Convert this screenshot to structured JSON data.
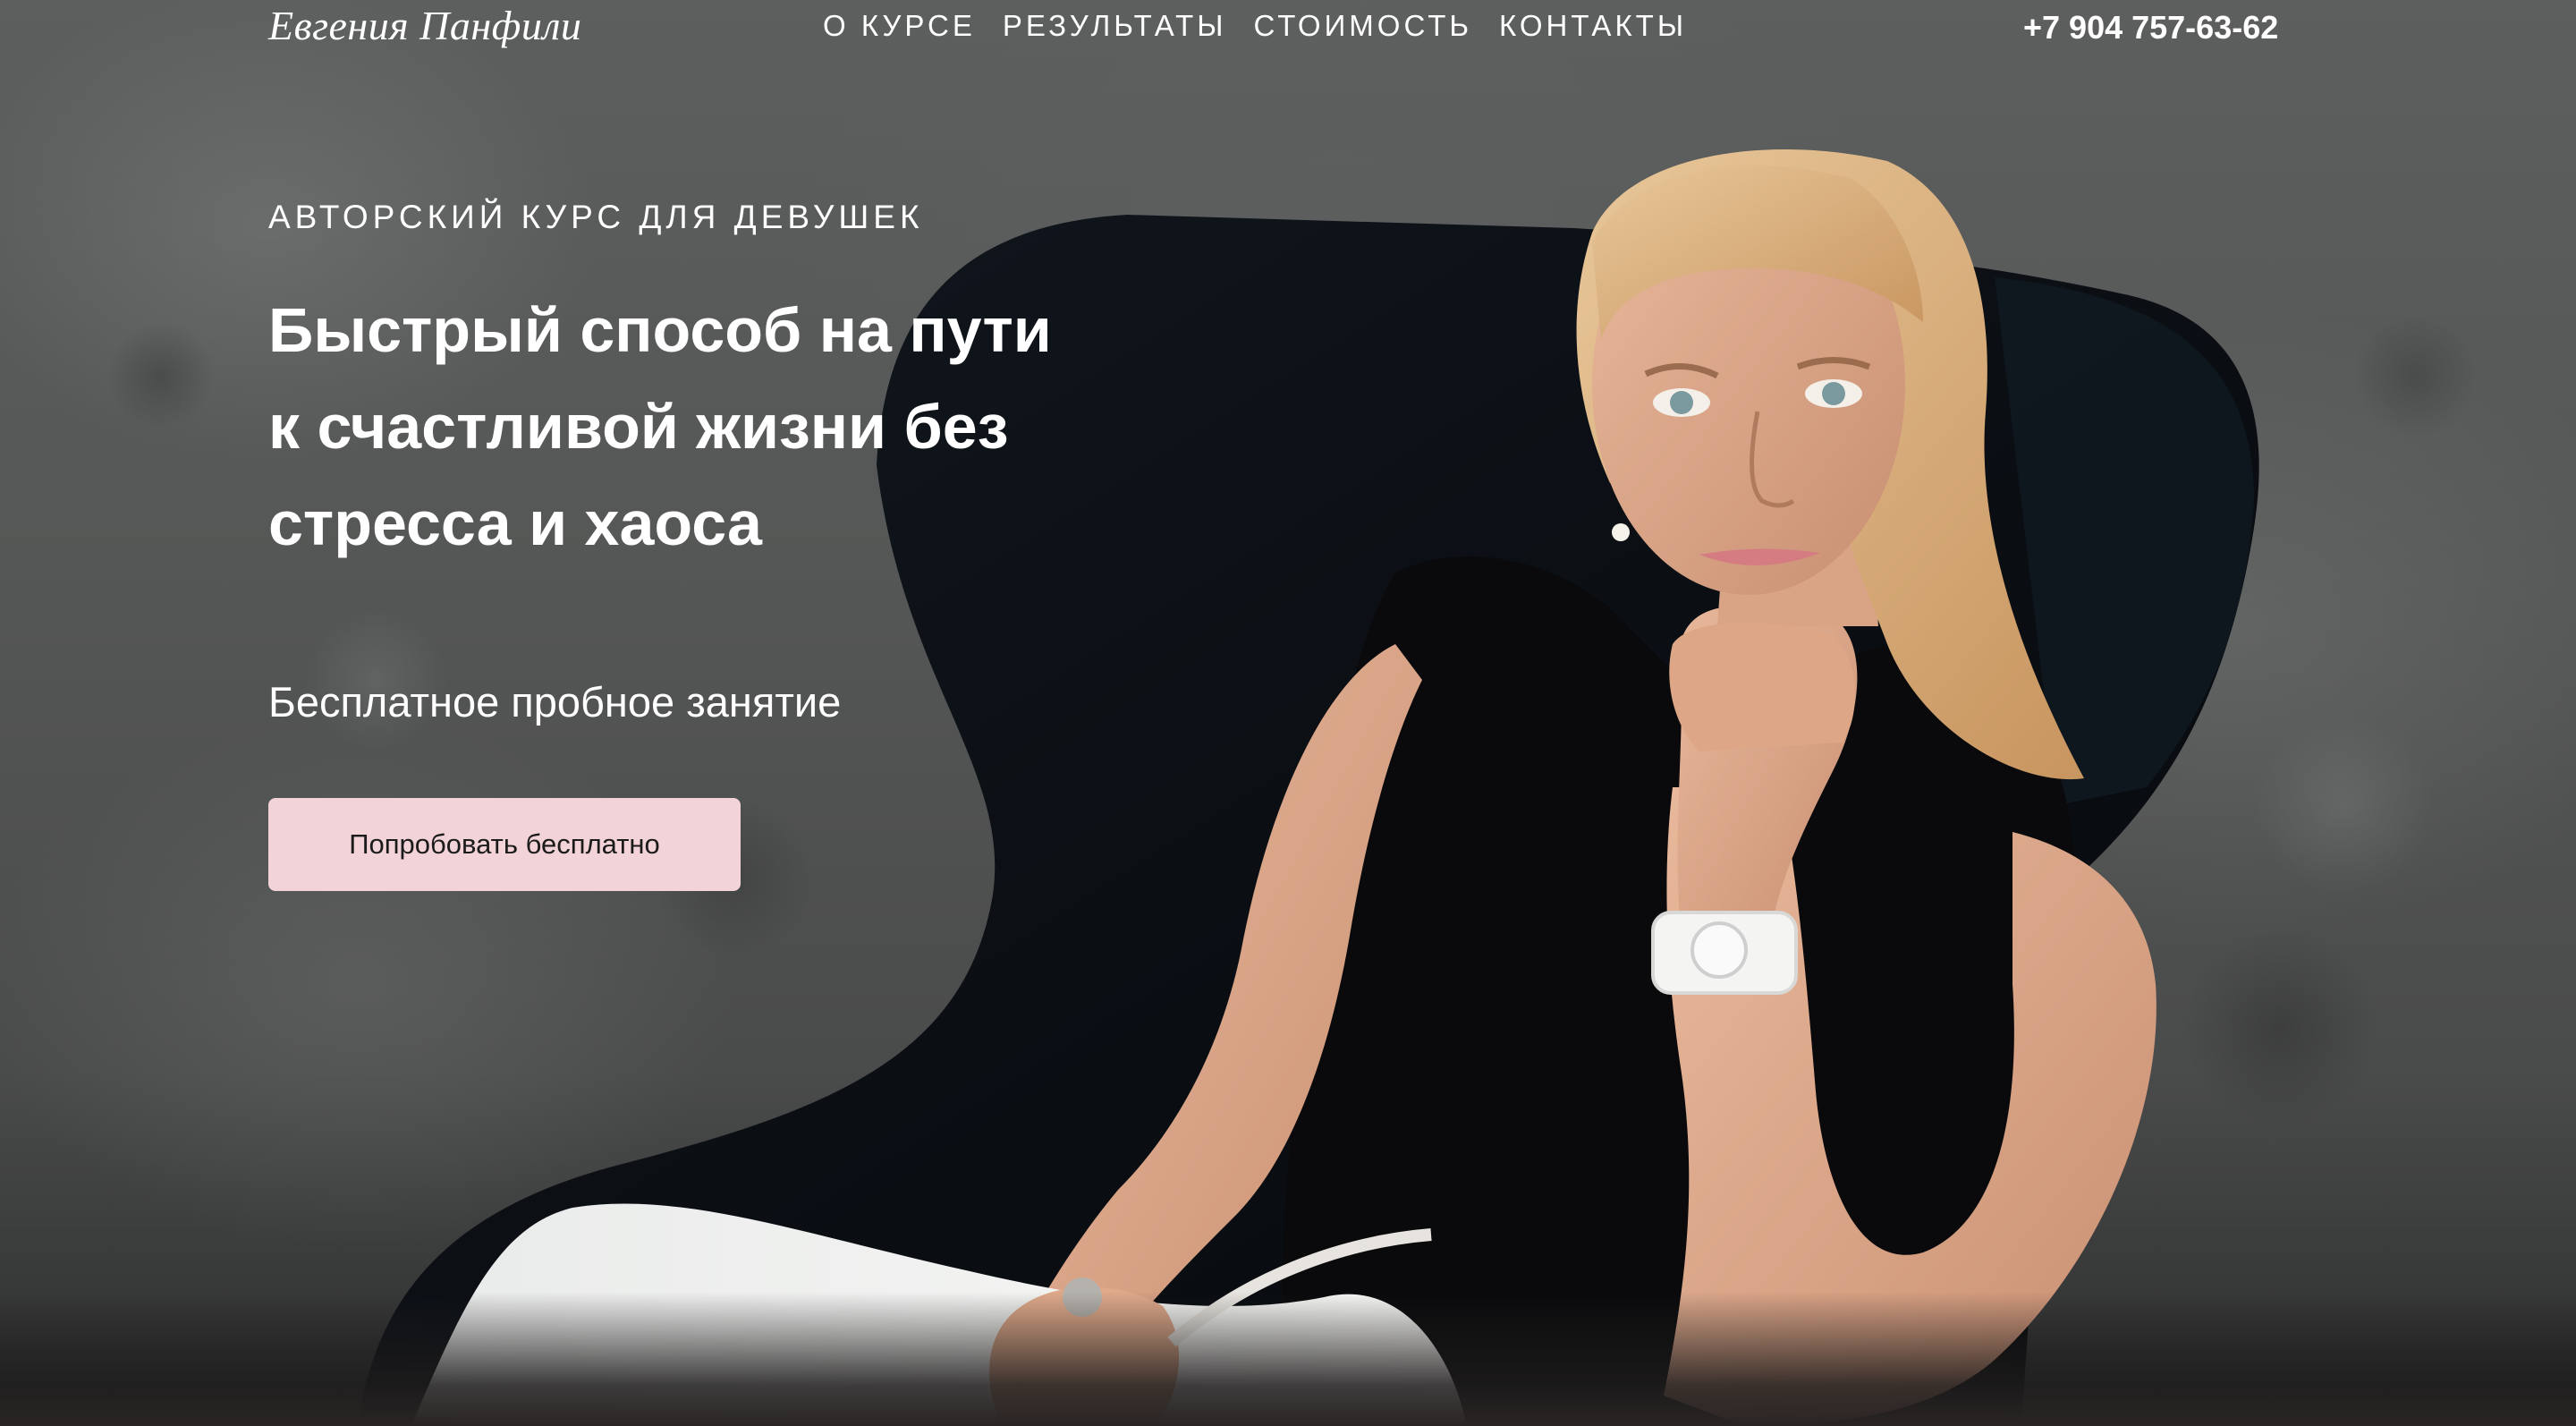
{
  "header": {
    "logo": "Евгения Панфили",
    "nav": [
      {
        "label": "О КУРСЕ"
      },
      {
        "label": "РЕЗУЛЬТАТЫ"
      },
      {
        "label": "СТОИМОСТЬ"
      },
      {
        "label": "КОНТАКТЫ"
      }
    ],
    "phone": "+7 904 757-63-62"
  },
  "hero": {
    "eyebrow": "АВТОРСКИЙ КУРС ДЛЯ ДЕВУШЕК",
    "headline_lines": [
      "Быстрый способ на пути",
      "к счастливой жизни без",
      "стресса и хаоса"
    ],
    "subline": "Бесплатное пробное занятие",
    "cta_label": "Попробовать бесплатно"
  },
  "colors": {
    "cta_background": "#f2d3d8",
    "text": "#ffffff"
  }
}
